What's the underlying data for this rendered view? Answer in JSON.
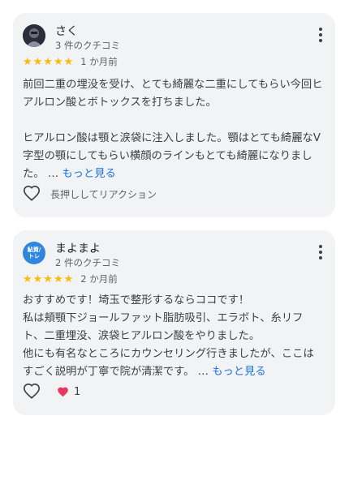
{
  "reviews": [
    {
      "reviewer": "さく",
      "review_count": "3 件のクチコミ",
      "stars": "★★★★★",
      "time": "1 か月前",
      "text": "前回二重の埋没を受け、とても綺麗な二重にしてもらい今回ヒアルロン酸とボトックスを打ちました。\n\nヒアルロン酸は顎と涙袋に注入しました。顎はとても綺麗なV字型の顎にしてもらい横顔のラインもとても綺麗になりました。 …",
      "more_label": "もっと見る",
      "react_label": "長押ししてリアクション"
    },
    {
      "reviewer": "まよまよ",
      "review_count": "2 件のクチコミ",
      "stars": "★★★★★",
      "time": "2 か月前",
      "avatar_text": "鮎資/\nトレ",
      "text": "おすすめです！埼玉で整形するならココです！\n私は頬顎下ジョールファット脂肪吸引、エラボト、糸リフト、二重埋没、涙袋ヒアルロン酸をやりました。\n他にも有名なところにカウンセリング行きましたが、ここはすごく説明が丁寧で院が清潔です。 …",
      "more_label": "もっと見る",
      "reaction_count": "1"
    }
  ],
  "colors": {
    "star": "#fbbc04",
    "link": "#1a73e8",
    "card_bg": "#f1f3f4",
    "love": "#e8365d"
  }
}
